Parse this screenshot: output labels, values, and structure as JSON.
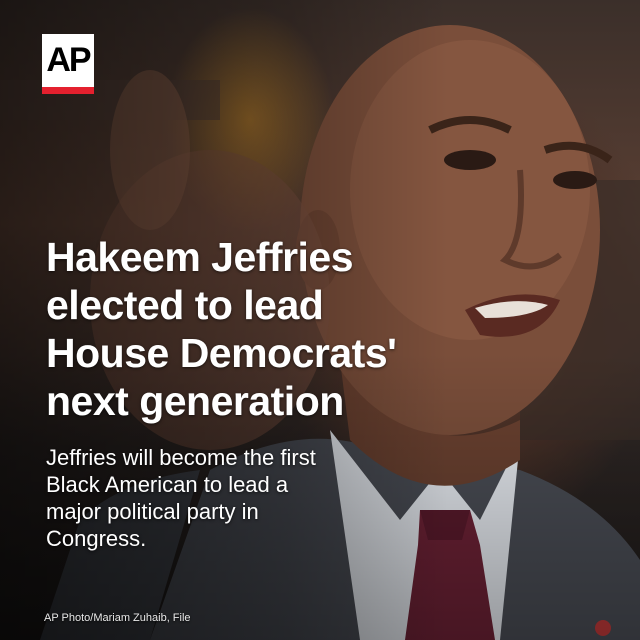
{
  "logo": {
    "text": "AP"
  },
  "headline": "Hakeem Jeffries elected to lead House Democrats' next generation",
  "subhead": "Jeffries will become the first Black American to lead a major political party in Congress.",
  "photo_credit": "AP Photo/Mariam Zuhaib, File",
  "colors": {
    "logo_bar": "#e4202e",
    "text": "#ffffff"
  }
}
